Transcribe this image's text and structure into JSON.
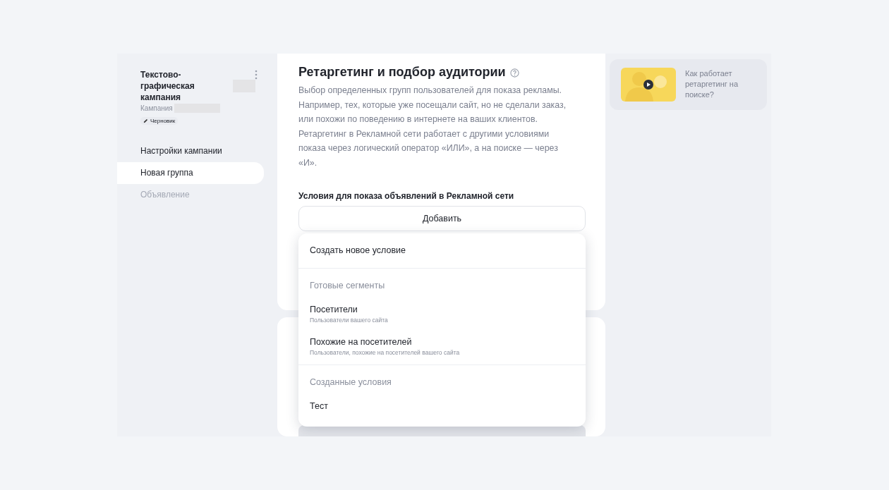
{
  "sidebar": {
    "campaign_title": "Текстово-графическая кампания",
    "campaign_label": "Кампания",
    "status_badge": "Черновик",
    "items": [
      {
        "label": "Настройки кампании",
        "selected": false,
        "disabled": false
      },
      {
        "label": "Новая группа",
        "selected": true,
        "disabled": false
      },
      {
        "label": "Объявление",
        "selected": false,
        "disabled": true
      }
    ]
  },
  "section": {
    "title": "Ретаргетинг и подбор аудитории",
    "description": "Выбор определенных групп пользователей для показа рекламы. Например, тех, которые уже посещали сайт, но не сделали заказ, или похожи по поведению в интернете на ваших клиентов. Ретаргетинг в Рекламной сети работает с другими условиями показа через логический оператор «ИЛИ», а на поиске — через «И».",
    "conditions_label": "Условия для показа объявлений в Рекламной сети",
    "add_button": "Добавить"
  },
  "dropdown": {
    "items": [
      {
        "kind": "action",
        "label": "Создать новое условие"
      },
      {
        "kind": "header",
        "label": "Готовые сегменты"
      },
      {
        "kind": "option",
        "label": "Посетители",
        "hint": "Пользователи вашего сайта"
      },
      {
        "kind": "option",
        "label": "Похожие на посетителей",
        "hint": "Пользователи, похожие на посетителей вашего сайта"
      },
      {
        "kind": "header",
        "label": "Созданные условия"
      },
      {
        "kind": "option",
        "label": "Тест"
      }
    ]
  },
  "help_card": {
    "kind": "picture",
    "text": "Как работает ретаргетинг на поиске?"
  }
}
